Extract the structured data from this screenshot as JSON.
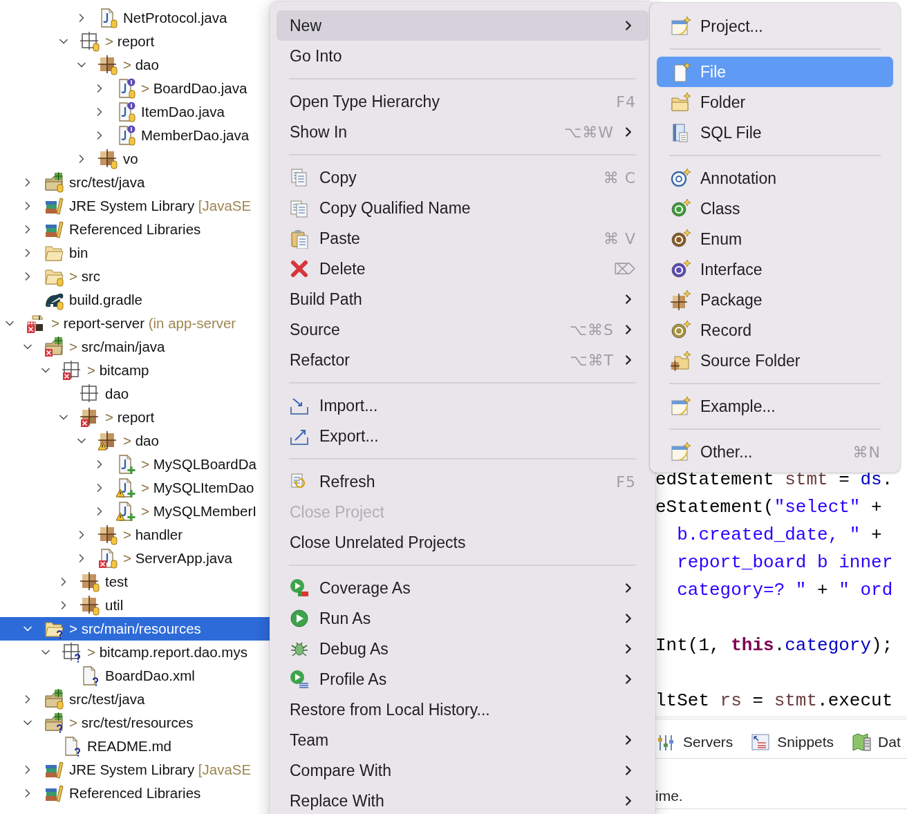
{
  "explorer": {
    "tree": [
      {
        "children": [
          {
            "children": [
              {
                "children": [
                  {
                    "children": [
                      {
                        "label": "NetProtocol.java",
                        "kind": "java",
                        "expanded": false,
                        "selected": false,
                        "repo": true
                      }
                    ]
                  },
                  {
                    "label": "report",
                    "prefix": ">",
                    "kind": "package-empty",
                    "expanded": true,
                    "selected": false,
                    "repo": true,
                    "children": [
                      {
                        "label": "dao",
                        "prefix": ">",
                        "kind": "package",
                        "expanded": true,
                        "selected": false,
                        "repo": true,
                        "children": [
                          {
                            "label": "BoardDao.java",
                            "prefix": ">",
                            "kind": "java",
                            "expanded": false,
                            "selected": false,
                            "interface": true,
                            "repo": true
                          },
                          {
                            "label": "ItemDao.java",
                            "kind": "java",
                            "expanded": false,
                            "selected": false,
                            "interface": true,
                            "repo": true
                          },
                          {
                            "label": "MemberDao.java",
                            "kind": "java",
                            "expanded": false,
                            "selected": false,
                            "interface": true,
                            "repo": true
                          }
                        ]
                      },
                      {
                        "label": "vo",
                        "kind": "package",
                        "expanded": false,
                        "selected": false,
                        "repo": true
                      }
                    ]
                  }
                ]
              }
            ]
          },
          {
            "label": "src/test/java",
            "kind": "source-folder",
            "expanded": false,
            "selected": false,
            "repo": true
          },
          {
            "label": "JRE System Library",
            "suffix": "[JavaSE",
            "kind": "library",
            "expanded": false,
            "selected": false
          },
          {
            "label": "Referenced Libraries",
            "kind": "library",
            "expanded": false,
            "selected": false
          },
          {
            "label": "bin",
            "kind": "folder",
            "expanded": false,
            "selected": false
          },
          {
            "label": "src",
            "prefix": ">",
            "kind": "folder",
            "expanded": false,
            "selected": false,
            "repo": true
          },
          {
            "label": "build.gradle",
            "kind": "gradle",
            "selected": false,
            "repo": true
          }
        ]
      },
      {
        "label": "report-server",
        "prefix": ">",
        "suffix": "(in app-server",
        "kind": "project",
        "expanded": true,
        "selected": false,
        "error": true,
        "children": [
          {
            "label": "src/main/java",
            "prefix": ">",
            "kind": "source-folder",
            "expanded": true,
            "selected": false,
            "error": true,
            "children": [
              {
                "label": "bitcamp",
                "prefix": ">",
                "kind": "package-empty",
                "expanded": true,
                "selected": false,
                "error": true,
                "children": [
                  {
                    "label": "dao",
                    "kind": "package-empty",
                    "selected": false
                  },
                  {
                    "label": "report",
                    "prefix": ">",
                    "kind": "package",
                    "expanded": true,
                    "selected": false,
                    "error": true,
                    "children": [
                      {
                        "label": "dao",
                        "prefix": ">",
                        "kind": "package",
                        "expanded": true,
                        "selected": false,
                        "warning": true,
                        "children": [
                          {
                            "label": "MySQLBoardDa",
                            "prefix": ">",
                            "kind": "java",
                            "expanded": false,
                            "selected": false,
                            "added": true
                          },
                          {
                            "label": "MySQLItemDao",
                            "prefix": ">",
                            "kind": "java",
                            "expanded": false,
                            "selected": false,
                            "warning": true,
                            "added": true
                          },
                          {
                            "label": "MySQLMemberI",
                            "prefix": ">",
                            "kind": "java",
                            "expanded": false,
                            "selected": false,
                            "warning": true,
                            "added": true
                          }
                        ]
                      },
                      {
                        "label": "handler",
                        "prefix": ">",
                        "kind": "package",
                        "expanded": false,
                        "selected": false,
                        "repo": true
                      },
                      {
                        "label": "ServerApp.java",
                        "prefix": ">",
                        "kind": "java",
                        "expanded": false,
                        "selected": false,
                        "error": true,
                        "repo": true
                      }
                    ]
                  },
                  {
                    "label": "test",
                    "kind": "package",
                    "expanded": false,
                    "selected": false,
                    "repo": true
                  },
                  {
                    "label": "util",
                    "kind": "package",
                    "expanded": false,
                    "selected": false,
                    "repo": true
                  }
                ]
              }
            ]
          },
          {
            "label": "src/main/resources",
            "prefix": ">",
            "kind": "folder",
            "expanded": true,
            "selected": true,
            "unversioned": true,
            "children": [
              {
                "label": "bitcamp.report.dao.mys",
                "prefix": ">",
                "kind": "package-empty",
                "expanded": true,
                "selected": false,
                "unversioned": true,
                "children": [
                  {
                    "label": "BoardDao.xml",
                    "kind": "page",
                    "selected": false,
                    "unversioned": true
                  }
                ]
              }
            ]
          },
          {
            "label": "src/test/java",
            "kind": "source-folder",
            "expanded": false,
            "selected": false,
            "repo": true
          },
          {
            "label": "src/test/resources",
            "prefix": ">",
            "kind": "source-folder",
            "expanded": true,
            "selected": false,
            "unversioned": true,
            "children": [
              {
                "label": "README.md",
                "kind": "page",
                "selected": false,
                "unversioned": true
              }
            ]
          },
          {
            "label": "JRE System Library",
            "suffix": "[JavaSE",
            "kind": "library",
            "expanded": false,
            "selected": false
          },
          {
            "label": "Referenced Libraries",
            "kind": "library",
            "expanded": false,
            "selected": false
          }
        ]
      }
    ]
  },
  "editor": {
    "lines": [
      {
        "kind": "code",
        "tokens": [
          {
            "text": "edStatement",
            "kind": "plain"
          },
          {
            "text": " stmt",
            "kind": "local"
          },
          {
            "text": " = ",
            "kind": "plain"
          },
          {
            "text": "ds",
            "kind": "field"
          },
          {
            "text": ".",
            "kind": "plain"
          }
        ]
      },
      {
        "kind": "code",
        "tokens": [
          {
            "text": "eStatement(",
            "kind": "plain"
          },
          {
            "text": "\"select\"",
            "kind": "string"
          },
          {
            "text": " +",
            "kind": "plain"
          }
        ]
      },
      {
        "kind": "code",
        "tokens": [
          {
            "text": "  b.created_date, \"",
            "kind": "string"
          },
          {
            "text": " +",
            "kind": "plain"
          }
        ]
      },
      {
        "kind": "code",
        "tokens": [
          {
            "text": "  report_board b inner",
            "kind": "string"
          }
        ]
      },
      {
        "kind": "code",
        "tokens": [
          {
            "text": "  category=? \"",
            "kind": "string"
          },
          {
            "text": " + ",
            "kind": "plain"
          },
          {
            "text": "\" ord",
            "kind": "string"
          }
        ]
      },
      {
        "kind": "blank"
      },
      {
        "kind": "code",
        "tokens": [
          {
            "text": "Int(1, ",
            "kind": "plain"
          },
          {
            "text": "this",
            "kind": "keyword"
          },
          {
            "text": ".",
            "kind": "plain"
          },
          {
            "text": "category",
            "kind": "field"
          },
          {
            "text": ");",
            "kind": "plain"
          }
        ]
      },
      {
        "kind": "blank"
      },
      {
        "kind": "code",
        "tokens": [
          {
            "text": "ltSet",
            "kind": "plain"
          },
          {
            "text": " rs",
            "kind": "local"
          },
          {
            "text": " = ",
            "kind": "plain"
          },
          {
            "text": "stmt",
            "kind": "local"
          },
          {
            "text": ".execut",
            "kind": "plain"
          }
        ]
      }
    ]
  },
  "bottom_panel": {
    "tabs": [
      {
        "label": "Servers",
        "kind": "servers",
        "selected": false
      },
      {
        "label": "Snippets",
        "kind": "snippets",
        "selected": false
      },
      {
        "label": "Dat",
        "kind": "data",
        "selected": false
      }
    ],
    "message": "ime."
  },
  "context_menu": {
    "items": [
      {
        "kind": "plain",
        "label": "New",
        "submenu": true,
        "selected": true,
        "disabled": false
      },
      {
        "kind": "plain",
        "label": "Go Into",
        "submenu": false,
        "selected": false,
        "disabled": false
      },
      {
        "kind": "separator"
      },
      {
        "kind": "plain",
        "label": "Open Type Hierarchy",
        "shortcut": "F4",
        "submenu": false,
        "selected": false,
        "disabled": false
      },
      {
        "kind": "plain",
        "label": "Show In",
        "shortcut": "⌥⌘W",
        "submenu": true,
        "selected": false,
        "disabled": false
      },
      {
        "kind": "separator"
      },
      {
        "kind": "copy",
        "label": "Copy",
        "shortcut": "⌘ C",
        "submenu": false,
        "selected": false,
        "disabled": false
      },
      {
        "kind": "copy-qualified",
        "label": "Copy Qualified Name",
        "submenu": false,
        "selected": false,
        "disabled": false
      },
      {
        "kind": "paste",
        "label": "Paste",
        "shortcut": "⌘ V",
        "submenu": false,
        "selected": false,
        "disabled": false
      },
      {
        "kind": "delete",
        "label": "Delete",
        "shortcut": "⌦",
        "submenu": false,
        "selected": false,
        "disabled": false
      },
      {
        "kind": "plain",
        "label": "Build Path",
        "submenu": true,
        "selected": false,
        "disabled": false
      },
      {
        "kind": "plain",
        "label": "Source",
        "shortcut": "⌥⌘S",
        "submenu": true,
        "selected": false,
        "disabled": false
      },
      {
        "kind": "plain",
        "label": "Refactor",
        "shortcut": "⌥⌘T",
        "submenu": true,
        "selected": false,
        "disabled": false
      },
      {
        "kind": "separator"
      },
      {
        "kind": "import",
        "label": "Import...",
        "submenu": false,
        "selected": false,
        "disabled": false
      },
      {
        "kind": "export",
        "label": "Export...",
        "submenu": false,
        "selected": false,
        "disabled": false
      },
      {
        "kind": "separator"
      },
      {
        "kind": "refresh",
        "label": "Refresh",
        "shortcut": "F5",
        "submenu": false,
        "selected": false,
        "disabled": false
      },
      {
        "kind": "plain",
        "label": "Close Project",
        "submenu": false,
        "selected": false,
        "disabled": true
      },
      {
        "kind": "plain",
        "label": "Close Unrelated Projects",
        "submenu": false,
        "selected": false,
        "disabled": false
      },
      {
        "kind": "separator"
      },
      {
        "kind": "coverage",
        "label": "Coverage As",
        "submenu": true,
        "selected": false,
        "disabled": false
      },
      {
        "kind": "run",
        "label": "Run As",
        "submenu": true,
        "selected": false,
        "disabled": false
      },
      {
        "kind": "debug",
        "label": "Debug As",
        "submenu": true,
        "selected": false,
        "disabled": false
      },
      {
        "kind": "profile",
        "label": "Profile As",
        "submenu": true,
        "selected": false,
        "disabled": false
      },
      {
        "kind": "plain",
        "label": "Restore from Local History...",
        "submenu": false,
        "selected": false,
        "disabled": false
      },
      {
        "kind": "plain",
        "label": "Team",
        "submenu": true,
        "selected": false,
        "disabled": false
      },
      {
        "kind": "plain",
        "label": "Compare With",
        "submenu": true,
        "selected": false,
        "disabled": false
      },
      {
        "kind": "plain",
        "label": "Replace With",
        "submenu": true,
        "selected": false,
        "disabled": false
      }
    ]
  },
  "new_submenu": {
    "items": [
      {
        "kind": "wizard",
        "label": "Project...",
        "selected": false
      },
      {
        "kind": "separator"
      },
      {
        "kind": "file",
        "label": "File",
        "selected": true
      },
      {
        "kind": "folder",
        "label": "Folder",
        "selected": false
      },
      {
        "kind": "sql",
        "label": "SQL File",
        "selected": false
      },
      {
        "kind": "separator"
      },
      {
        "kind": "annotation",
        "label": "Annotation",
        "selected": false
      },
      {
        "kind": "class",
        "label": "Class",
        "selected": false
      },
      {
        "kind": "enum",
        "label": "Enum",
        "selected": false
      },
      {
        "kind": "interface",
        "label": "Interface",
        "selected": false
      },
      {
        "kind": "package",
        "label": "Package",
        "selected": false
      },
      {
        "kind": "record",
        "label": "Record",
        "selected": false
      },
      {
        "kind": "source-folder",
        "label": "Source Folder",
        "selected": false
      },
      {
        "kind": "separator"
      },
      {
        "kind": "wizard",
        "label": "Example...",
        "selected": false
      },
      {
        "kind": "separator"
      },
      {
        "kind": "wizard",
        "label": "Other...",
        "shortcut": "⌘N",
        "selected": false
      }
    ]
  }
}
